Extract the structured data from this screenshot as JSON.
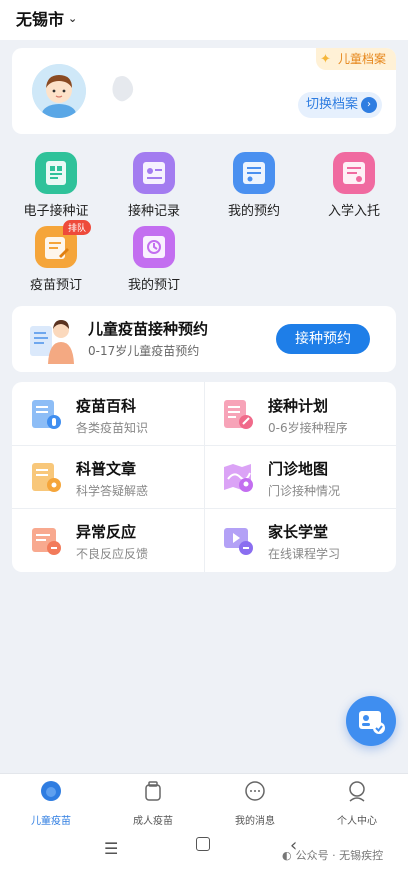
{
  "header": {
    "city": "无锡市",
    "city_icon": "chevron-down-icon"
  },
  "profile": {
    "tag": "儿童档案",
    "switch_label": "切换档案",
    "avatar_icon": "child-avatar"
  },
  "quick_actions": [
    {
      "label": "电子接种证",
      "icon": "vaccine-certificate-icon",
      "color": "#2fc29a"
    },
    {
      "label": "接种记录",
      "icon": "vaccination-record-icon",
      "color": "#a37cf0"
    },
    {
      "label": "我的预约",
      "icon": "my-appointment-icon",
      "color": "#4a90f0"
    },
    {
      "label": "入学入托",
      "icon": "school-enrollment-icon",
      "color": "#f06aa0"
    },
    {
      "label": "疫苗预订",
      "icon": "vaccine-booking-icon",
      "color": "#f5a53a",
      "badge": "排队"
    },
    {
      "label": "我的预订",
      "icon": "my-booking-icon",
      "color": "#c36ef0"
    }
  ],
  "appointment": {
    "title": "儿童疫苗接种预约",
    "subtitle": "0-17岁儿童疫苗预约",
    "button": "接种预约"
  },
  "services": [
    {
      "title": "疫苗百科",
      "subtitle": "各类疫苗知识",
      "icon": "vaccine-encyclopedia-icon",
      "color": "#5a9df2"
    },
    {
      "title": "接种计划",
      "subtitle": "0-6岁接种程序",
      "icon": "vaccination-plan-icon",
      "color": "#f06a8a"
    },
    {
      "title": "科普文章",
      "subtitle": "科学答疑解惑",
      "icon": "science-article-icon",
      "color": "#f5a53a"
    },
    {
      "title": "门诊地图",
      "subtitle": "门诊接种情况",
      "icon": "clinic-map-icon",
      "color": "#c36ef0"
    },
    {
      "title": "异常反应",
      "subtitle": "不良反应反馈",
      "icon": "adverse-reaction-icon",
      "color": "#f27a5a"
    },
    {
      "title": "家长学堂",
      "subtitle": "在线课程学习",
      "icon": "parent-class-icon",
      "color": "#8a6ef0"
    }
  ],
  "tabbar": [
    {
      "label": "儿童疫苗",
      "icon": "child-vaccine-tab-icon",
      "active": true
    },
    {
      "label": "成人疫苗",
      "icon": "adult-vaccine-tab-icon",
      "active": false
    },
    {
      "label": "我的消息",
      "icon": "messages-tab-icon",
      "active": false
    },
    {
      "label": "个人中心",
      "icon": "profile-tab-icon",
      "active": false
    }
  ],
  "watermark": "公众号 · 无锡疾控",
  "colors": {
    "primary": "#1e7ee8",
    "accent_orange": "#e6861b",
    "badge_red": "#ee4a3b"
  }
}
